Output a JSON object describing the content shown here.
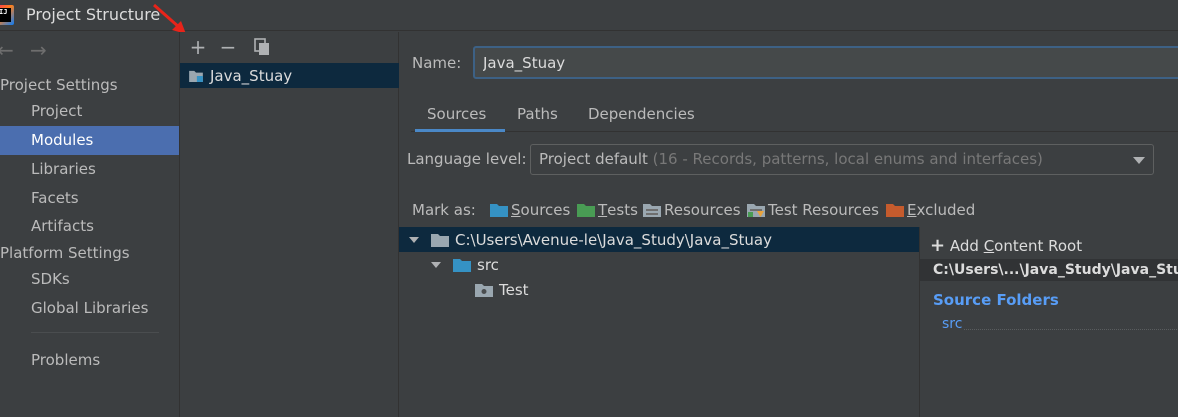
{
  "window": {
    "title": "Project Structure"
  },
  "sidebar": {
    "sections": {
      "project_settings": "Project Settings",
      "platform_settings": "Platform Settings"
    },
    "items": {
      "project": "Project",
      "modules": "Modules",
      "libraries": "Libraries",
      "facets": "Facets",
      "artifacts": "Artifacts",
      "sdks": "SDKs",
      "global_libraries": "Global Libraries",
      "problems": "Problems"
    },
    "active": "Modules"
  },
  "modules": {
    "toolbar": {
      "add": "+",
      "remove": "−"
    },
    "list": [
      "Java_Stuay"
    ]
  },
  "main": {
    "name_label": "Name:",
    "name_value": "Java_Stuay",
    "tabs": {
      "sources": "Sources",
      "paths": "Paths",
      "dependencies": "Dependencies"
    },
    "active_tab": "Sources",
    "language_level": {
      "label": "Language level:",
      "value": "Project default",
      "detail": "(16 - Records, patterns, local enums and interfaces)"
    },
    "mark_as": {
      "label": "Mark as:",
      "sources": {
        "first": "S",
        "rest": "ources"
      },
      "tests": {
        "first": "T",
        "rest": "ests"
      },
      "resources": "Resources",
      "test_resources": "Test Resources",
      "excluded": {
        "first": "E",
        "rest": "xcluded"
      }
    },
    "tree": {
      "root": "C:\\Users\\Avenue-le\\Java_Study\\Java_Stuay",
      "src": "src",
      "test": "Test"
    },
    "content_root": {
      "add_label_pre": "Add ",
      "add_label_mnemonic": "C",
      "add_label_post": "ontent Root",
      "path": "C:\\Users\\...\\Java_Study\\Java_Stuay",
      "source_folders_title": "Source Folders",
      "source_folders": [
        "src"
      ]
    }
  },
  "colors": {
    "accent": "#4b6eaf",
    "selection": "#0d293e",
    "source_folder": "#3592c4",
    "test_folder": "#499c54",
    "excluded_folder": "#c55b2d",
    "link_blue": "#589df6"
  }
}
